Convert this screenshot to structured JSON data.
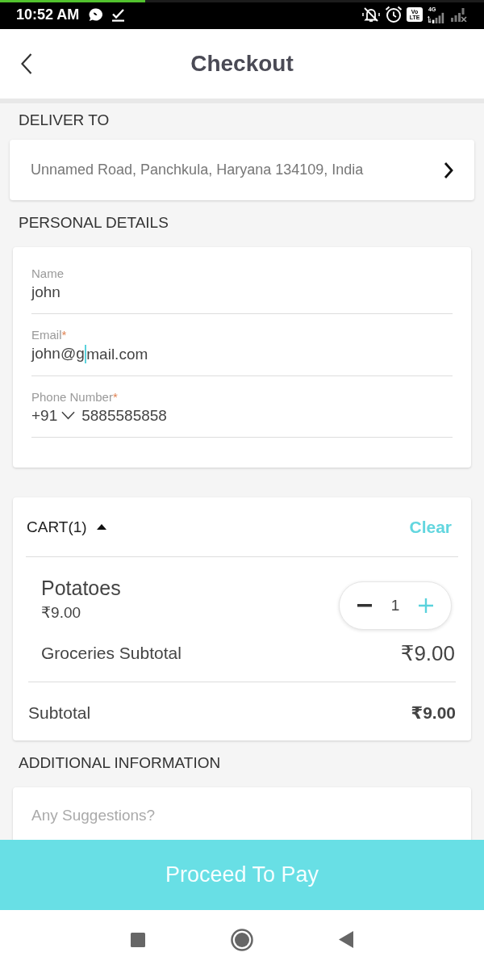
{
  "status_bar": {
    "time": "10:52 AM",
    "network_type": "4G",
    "volte_lines": [
      "Vo",
      "LTE"
    ],
    "progress": {
      "level": 0.3
    }
  },
  "header": {
    "title": "Checkout"
  },
  "delivery": {
    "heading": "DELIVER TO",
    "address": "Unnamed Road, Panchkula, Haryana 134109, India"
  },
  "personal_details": {
    "heading": "PERSONAL DETAILS",
    "fields": [
      {
        "kind": "text",
        "label": "Name",
        "value": [
          "john"
        ],
        "focused": false
      },
      {
        "kind": "text",
        "label": "Email",
        "required_mark": "*",
        "value": [
          "john@g",
          "mail.com"
        ],
        "focused": true
      },
      {
        "kind": "phone",
        "label": "Phone Number",
        "required_mark": "*",
        "country_code": "+91",
        "value": [
          "5885585858"
        ],
        "focused": false
      }
    ]
  },
  "cart": {
    "title": "CART(1)",
    "expanded": true,
    "clear_label": "Clear",
    "items": [
      {
        "name": "Potatoes",
        "price": "₹9.00",
        "quantity": "1"
      }
    ],
    "groceries_subtotal": {
      "label": "Groceries Subtotal",
      "amount": "₹9.00"
    },
    "subtotal": {
      "label": "Subtotal",
      "amount": "₹9.00"
    }
  },
  "additional_information": {
    "heading": "ADDITIONAL INFORMATION",
    "placeholder": "Any Suggestions?"
  },
  "proceed_button": {
    "label": "Proceed To Pay"
  }
}
